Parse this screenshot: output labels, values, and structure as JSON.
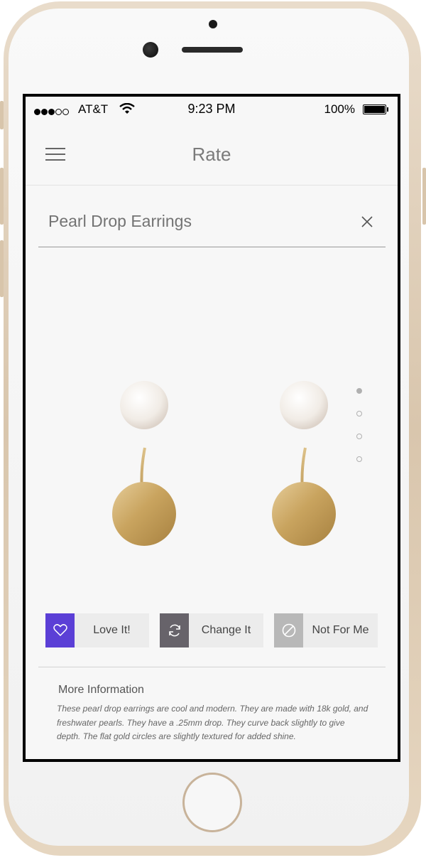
{
  "status_bar": {
    "carrier": "AT&T",
    "time": "9:23 PM",
    "battery": "100%",
    "signal_bars_filled": 3,
    "signal_bars_total": 5
  },
  "navbar": {
    "title": "Rate",
    "menu_icon": "hamburger-icon"
  },
  "product": {
    "title": "Pearl Drop Earrings",
    "close_icon": "close-icon",
    "image_pages": 4,
    "active_page": 1
  },
  "actions": [
    {
      "label": "Love It!",
      "icon": "heart-icon",
      "color": "#5b3fd6"
    },
    {
      "label": "Change It",
      "icon": "refresh-icon",
      "color": "#67636a"
    },
    {
      "label": "Not For Me",
      "icon": "block-icon",
      "color": "#b8b8b8"
    }
  ],
  "more_info": {
    "title": "More Information",
    "body": "These pearl drop earrings are cool and modern. They are made with 18k gold, and freshwater pearls. They have a .25mm drop. They curve back slightly to give depth. The flat gold circles are slightly textured for added shine."
  }
}
